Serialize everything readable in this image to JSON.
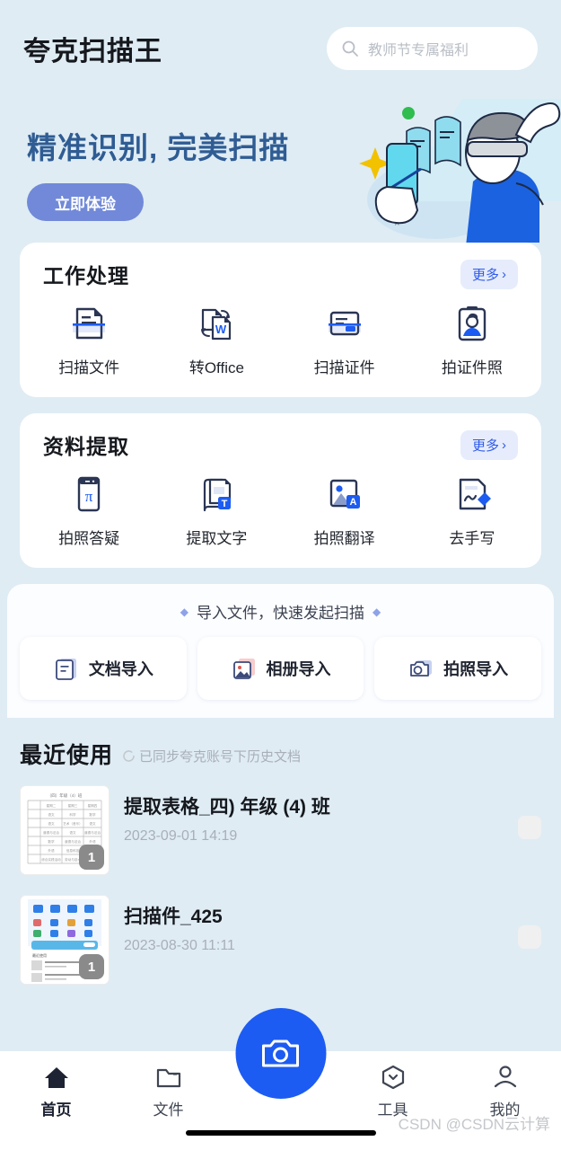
{
  "header": {
    "app_title": "夸克扫描王",
    "search_placeholder": "教师节专属福利",
    "search_icon": "search-icon"
  },
  "banner": {
    "title": "精准识别, 完美扫描",
    "cta_label": "立即体验"
  },
  "sections": [
    {
      "title": "工作处理",
      "more_label": "更多",
      "more_chevron": "›",
      "items": [
        {
          "label": "扫描文件",
          "icon": "scan-document-icon"
        },
        {
          "label": "转Office",
          "icon": "convert-office-icon"
        },
        {
          "label": "扫描证件",
          "icon": "scan-id-card-icon"
        },
        {
          "label": "拍证件照",
          "icon": "id-photo-icon"
        }
      ]
    },
    {
      "title": "资料提取",
      "more_label": "更多",
      "more_chevron": "›",
      "items": [
        {
          "label": "拍照答疑",
          "icon": "math-solver-icon"
        },
        {
          "label": "提取文字",
          "icon": "extract-text-icon"
        },
        {
          "label": "拍照翻译",
          "icon": "photo-translate-icon"
        },
        {
          "label": "去手写",
          "icon": "remove-handwriting-icon"
        }
      ]
    }
  ],
  "import": {
    "heading": "导入文件，快速发起扫描",
    "diamond": "◆",
    "buttons": [
      {
        "label": "文档导入",
        "icon": "document-import-icon"
      },
      {
        "label": "相册导入",
        "icon": "gallery-import-icon"
      },
      {
        "label": "拍照导入",
        "icon": "camera-import-icon"
      }
    ]
  },
  "recent": {
    "title": "最近使用",
    "sync_text": "已同步夸克账号下历史文档",
    "sync_icon": "sync-icon",
    "files": [
      {
        "name": "提取表格_四) 年级 (4) 班",
        "date": "2023-09-01 14:19",
        "page_count": "1",
        "thumb": "table-document-thumbnail"
      },
      {
        "name": "扫描件_425",
        "date": "2023-08-30 11:11",
        "page_count": "1",
        "thumb": "app-screenshot-thumbnail"
      }
    ]
  },
  "nav": {
    "items": [
      {
        "label": "首页",
        "icon": "home-icon",
        "active": true
      },
      {
        "label": "文件",
        "icon": "folder-icon",
        "active": false
      },
      {
        "label": "工具",
        "icon": "tools-hexagon-icon",
        "active": false
      },
      {
        "label": "我的",
        "icon": "person-icon",
        "active": false
      }
    ],
    "fab_icon": "camera-icon"
  },
  "watermark": "CSDN @CSDN云计算",
  "colors": {
    "page_bg": "#dfecf4",
    "accent_blue": "#1d5cf2",
    "banner_text": "#2f5c93",
    "cta_bg": "#7189d8",
    "more_pill_bg": "#e6ecfb",
    "more_pill_text": "#2f5bea"
  }
}
